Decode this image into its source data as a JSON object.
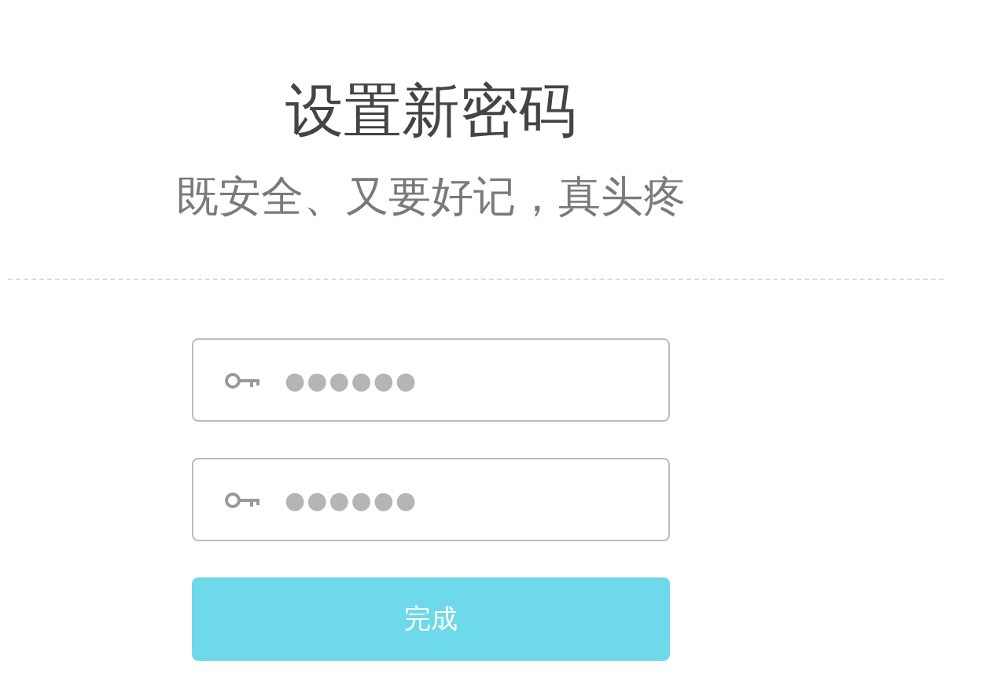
{
  "title": "设置新密码",
  "subtitle": "既安全、又要好记，真头疼",
  "fields": [
    {
      "kind": "password",
      "value": "●●●●●●"
    },
    {
      "kind": "password",
      "value": "●●●●●●"
    }
  ],
  "submit_button": {
    "label": "完成"
  }
}
